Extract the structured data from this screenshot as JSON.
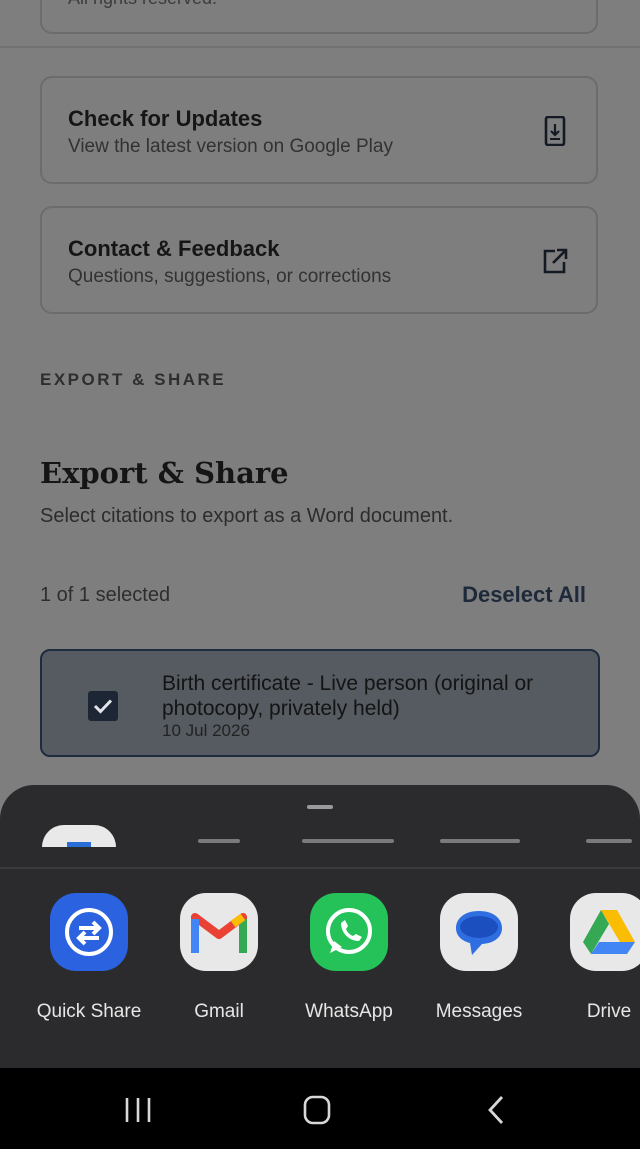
{
  "top_card": {
    "text": "All rights reserved."
  },
  "cards": [
    {
      "title": "Check for Updates",
      "subtitle": "View the latest version on Google Play",
      "icon": "phone-download-icon"
    },
    {
      "title": "Contact & Feedback",
      "subtitle": "Questions, suggestions, or corrections",
      "icon": "external-link-icon"
    }
  ],
  "section_label": "EXPORT & SHARE",
  "export": {
    "heading": "Export & Share",
    "subtitle": "Select citations to export as a Word document.",
    "selected_count": "1 of 1 selected",
    "deselect_label": "Deselect All"
  },
  "citation": {
    "title": "Birth certificate - Live person (original or photocopy, privately held)",
    "date": "10 Jul 2026",
    "checked": true
  },
  "share_sheet": {
    "apps": [
      {
        "label": "Quick Share",
        "icon": "quick-share-icon"
      },
      {
        "label": "Gmail",
        "icon": "gmail-icon"
      },
      {
        "label": "WhatsApp",
        "icon": "whatsapp-icon"
      },
      {
        "label": "Messages",
        "icon": "messages-icon"
      },
      {
        "label": "Drive",
        "icon": "drive-icon"
      }
    ]
  },
  "colors": {
    "scrim": "#7e7e7e",
    "sheet": "#2b2b2d",
    "accent_dark": "#1d2634",
    "quick_share": "#2a62e0",
    "whatsapp": "#25c25a"
  },
  "navigation": {
    "recents": "recents-icon",
    "home": "home-icon",
    "back": "back-icon"
  }
}
